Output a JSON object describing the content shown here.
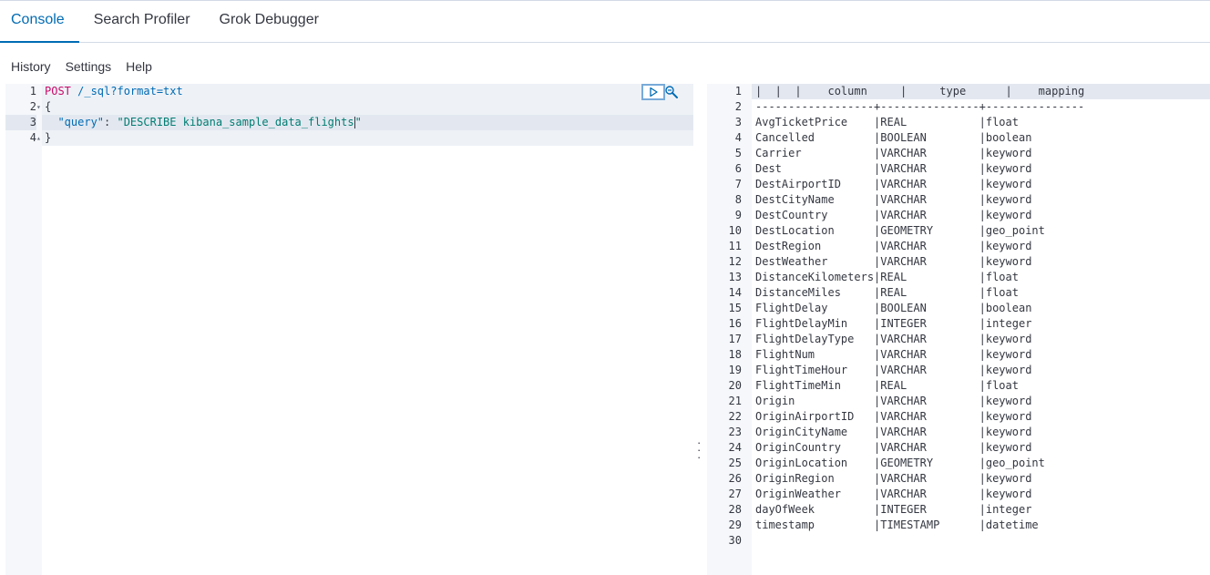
{
  "tabs": [
    "Console",
    "Search Profiler",
    "Grok Debugger"
  ],
  "menu": [
    "History",
    "Settings",
    "Help"
  ],
  "request": {
    "method": "POST",
    "path": " /_sql?format=txt",
    "open_brace": "{",
    "key": "\"query\"",
    "colon": ": ",
    "value": "\"DESCRIBE kibana_sample_data_flights",
    "value_close": "\"",
    "close_brace": "}",
    "line_numbers": [
      "1",
      "2",
      "3",
      "4"
    ]
  },
  "icons": {
    "run": "play-icon",
    "settings": "wrench-icon",
    "resize": "vertical-dots-icon"
  },
  "response": {
    "header_line": "|  |  |    column     |     type      |    mapping    ",
    "separator_line": "------------------+---------------+---------------",
    "line_numbers": [
      "1",
      "2",
      "3",
      "4",
      "5",
      "6",
      "7",
      "8",
      "9",
      "10",
      "11",
      "12",
      "13",
      "14",
      "15",
      "16",
      "17",
      "18",
      "19",
      "20",
      "21",
      "22",
      "23",
      "24",
      "25",
      "26",
      "27",
      "28",
      "29",
      "30"
    ],
    "rows": [
      "AvgTicketPrice    |REAL           |float          ",
      "Cancelled         |BOOLEAN        |boolean        ",
      "Carrier           |VARCHAR        |keyword        ",
      "Dest              |VARCHAR        |keyword        ",
      "DestAirportID     |VARCHAR        |keyword        ",
      "DestCityName      |VARCHAR        |keyword        ",
      "DestCountry       |VARCHAR        |keyword        ",
      "DestLocation      |GEOMETRY       |geo_point      ",
      "DestRegion        |VARCHAR        |keyword        ",
      "DestWeather       |VARCHAR        |keyword        ",
      "DistanceKilometers|REAL           |float          ",
      "DistanceMiles     |REAL           |float          ",
      "FlightDelay       |BOOLEAN        |boolean        ",
      "FlightDelayMin    |INTEGER        |integer        ",
      "FlightDelayType   |VARCHAR        |keyword        ",
      "FlightNum         |VARCHAR        |keyword        ",
      "FlightTimeHour    |VARCHAR        |keyword        ",
      "FlightTimeMin     |REAL           |float          ",
      "Origin            |VARCHAR        |keyword        ",
      "OriginAirportID   |VARCHAR        |keyword        ",
      "OriginCityName    |VARCHAR        |keyword        ",
      "OriginCountry     |VARCHAR        |keyword        ",
      "OriginLocation    |GEOMETRY       |geo_point      ",
      "OriginRegion      |VARCHAR        |keyword        ",
      "OriginWeather     |VARCHAR        |keyword        ",
      "dayOfWeek         |INTEGER        |integer        ",
      "timestamp         |TIMESTAMP      |datetime       "
    ]
  }
}
